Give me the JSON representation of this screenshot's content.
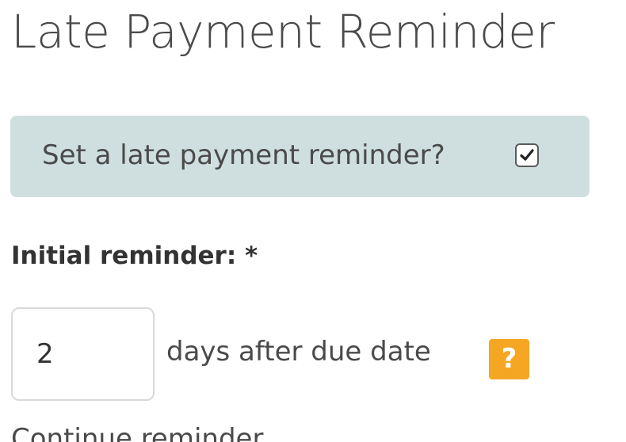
{
  "page": {
    "title": "Late Payment Reminder"
  },
  "reminder_toggle": {
    "label": "Set a late payment reminder?",
    "checked": true
  },
  "initial_reminder": {
    "label": "Initial reminder: *",
    "value": "2",
    "suffix": "days after due date",
    "help_icon": "question-mark-icon",
    "help_text": "?"
  },
  "next_section": {
    "label_partial": "Continue reminder"
  },
  "colors": {
    "notice_background": "#cfdfe0",
    "help_badge": "#f5a623"
  }
}
